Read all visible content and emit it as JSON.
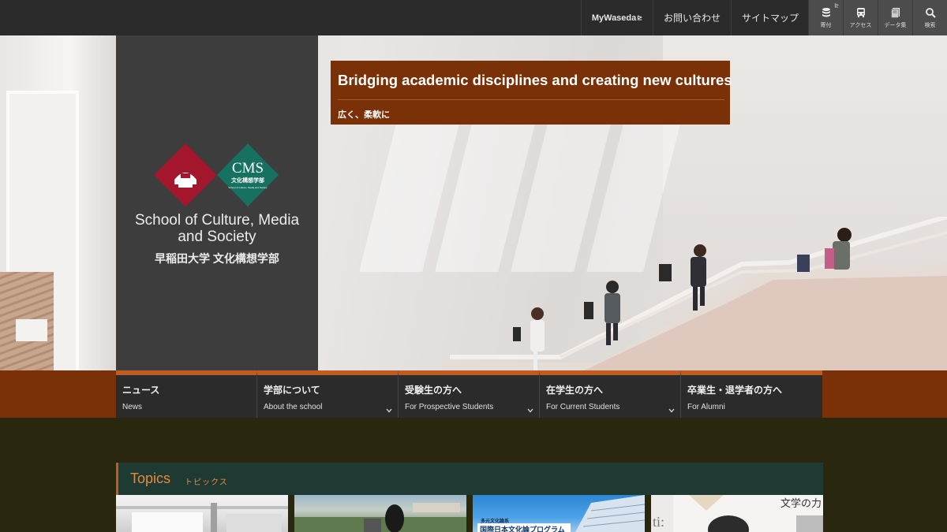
{
  "topbar": {
    "links": [
      {
        "label": "MyWaseda",
        "ext": "⊵"
      },
      {
        "label": "お問い合わせ"
      },
      {
        "label": "サイトマップ"
      }
    ],
    "icons": [
      {
        "name": "donation-icon",
        "label": "寄付",
        "ext": "⊵"
      },
      {
        "name": "bus-icon",
        "label": "アクセス"
      },
      {
        "name": "book-icon",
        "label": "データ集"
      },
      {
        "name": "search-icon",
        "label": "検索"
      }
    ]
  },
  "logo": {
    "cms_text": "CMS",
    "cms_sub_ja": "文化構想学部",
    "cms_sub_en": "School of Culture, Media and Society",
    "title_en_line1": "School of Culture, Media",
    "title_en_line2": "and Society",
    "title_ja": "早稲田大学 文化構想学部"
  },
  "tagline": {
    "en": "Bridging academic disciplines and creating new cultures",
    "ja": "広く、柔軟に"
  },
  "nav": [
    {
      "ja": "ニュース",
      "en": "News",
      "dropdown": false
    },
    {
      "ja": "学部について",
      "en": "About the school",
      "dropdown": true
    },
    {
      "ja": "受験生の方へ",
      "en": "For Prospective Students",
      "dropdown": true
    },
    {
      "ja": "在学生の方へ",
      "en": "For Current Students",
      "dropdown": true
    },
    {
      "ja": "卒業生・退学者の方へ",
      "en": "For Alumni",
      "dropdown": false
    }
  ],
  "topics": {
    "title_en": "Topics",
    "title_ja": "トピックス",
    "cards": [
      {
        "caption": ""
      },
      {
        "caption": ""
      },
      {
        "caption_small": "多元文化論系",
        "caption": "国際日本文化論プログラム"
      },
      {
        "caption": "文学の力"
      }
    ]
  },
  "colors": {
    "topbar": "#2b2b2b",
    "brand_brown": "#7a3108",
    "accent_orange": "#c05b22",
    "topics_green": "#1e3a33",
    "topics_text": "#e58a3c",
    "waseda_red": "#a3162b",
    "cms_green": "#167161"
  }
}
